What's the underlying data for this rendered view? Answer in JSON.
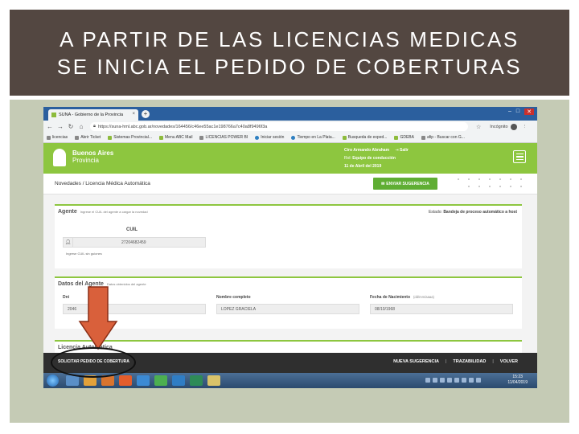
{
  "slide": {
    "title_line1": "A PARTIR DE LAS LICENCIAS MEDICAS",
    "title_line2": "SE INICIA EL PEDIDO DE COBERTURAS",
    "title_bg": "#534741",
    "content_bg": "#c5cbb5"
  },
  "browser": {
    "tab_title": "SUNA - Gobierno de la Provincia",
    "tab_close": "×",
    "new_tab": "+",
    "url": "https://suna-hml.abc.gob.ar/novedades/164456/c46ee55ac1e198766a7c40a8f9496f3a",
    "incognito_label": "Incógnito",
    "bookmarks": [
      {
        "label": "licencias"
      },
      {
        "label": "Abrir Ticket"
      },
      {
        "label": "Sistemas Provincial..."
      },
      {
        "label": "Menu ABC Mail"
      },
      {
        "label": "LICENCIAS POWER BI"
      },
      {
        "label": "Iniciar sesión"
      },
      {
        "label": "Tiempo en La Plata..."
      },
      {
        "label": "Busqueda de exped..."
      },
      {
        "label": "GDEBA"
      },
      {
        "label": "afip - Buscar con G..."
      }
    ]
  },
  "app": {
    "logo_line1": "Buenos Aires",
    "logo_line2": "Provincia",
    "user_name": "Ciro Armando Abraham",
    "salir": "Salir",
    "rol_label": "Rol:",
    "rol_value": "Equipo de conducción",
    "date": "11 de Abril del 2019",
    "brand_green": "#8dc63f",
    "breadcrumb": "Novedades / Licencia Médica Automática",
    "send_button": "ENVIAR SUGERENCIA",
    "agente": {
      "title": "Agente",
      "hint": "Ingrese el CUIL del agente a cargar la novedad",
      "estado_label": "Estado:",
      "estado_value": "Bandeja de proceso automático a host",
      "cuil_label": "CUIL",
      "cuil_value": "27204682459",
      "cuil_help": "Ingrese CUIL sin guiones"
    },
    "datos": {
      "title": "Datos del Agente",
      "hint": "Datos obtenidos del agente",
      "dni_label": "Dni",
      "dni_value": "2046",
      "nombre_label": "Nombre completo",
      "nombre_value": "LOPEZ GRACIELA",
      "fecha_label": "Fecha de Nacimiento",
      "fecha_hint": "(dd/mm/aaaa)",
      "fecha_value": "08/10/1968"
    },
    "licencia_title": "Licencia Automática",
    "actions": {
      "solicitar": "SOLICITAR PEDIDO DE COBERTURA",
      "nueva": "NUEVA SUGERENCIA",
      "trazabilidad": "TRAZABILIDAD",
      "volver": "VOLVER",
      "separator": "|"
    }
  },
  "taskbar": {
    "time": "15:23",
    "date": "11/04/2019"
  },
  "annotation": {
    "arrow_color": "#d9603b"
  }
}
